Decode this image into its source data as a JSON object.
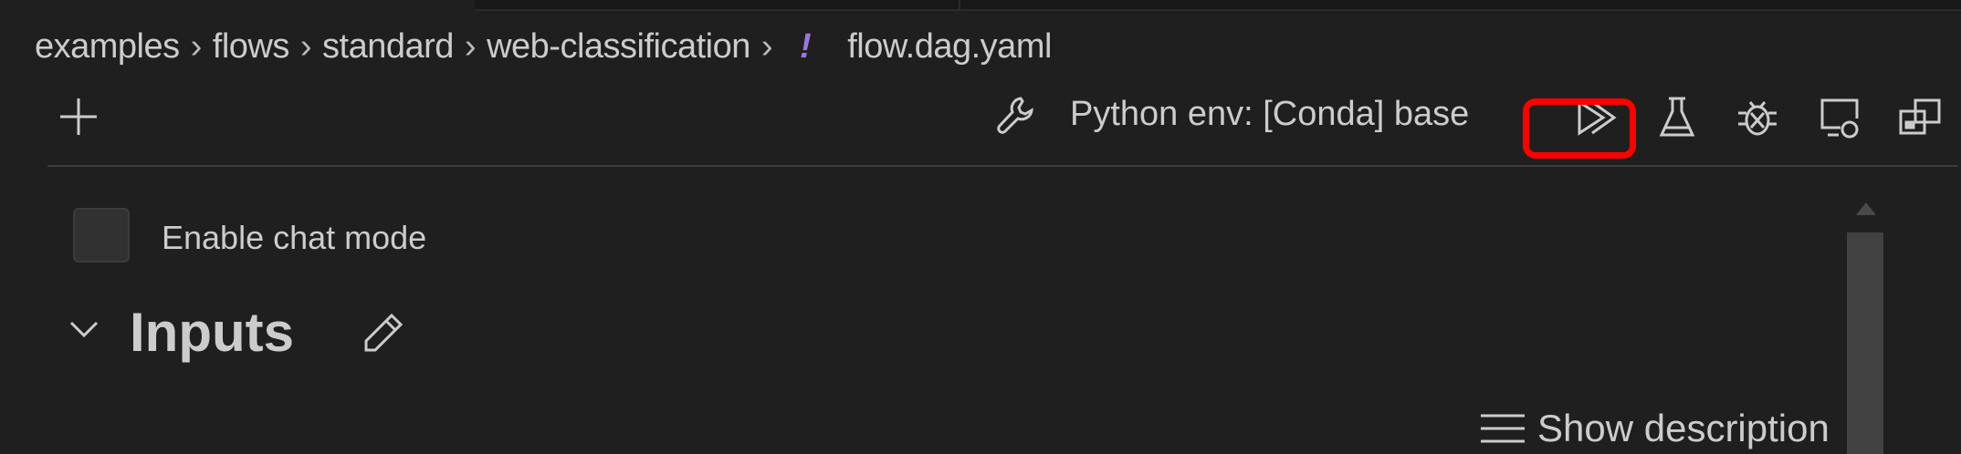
{
  "breadcrumb": {
    "items": [
      "examples",
      "flows",
      "standard",
      "web-classification"
    ],
    "file_icon": "yaml-exclamation-icon",
    "file": "flow.dag.yaml",
    "separator": "›"
  },
  "toolbar": {
    "add_icon": "plus-icon",
    "env_icon": "wrench-icon",
    "env_label": "Python env: [Conda] base",
    "actions": [
      "run-all-icon",
      "test-flask-icon",
      "debug-bug-icon",
      "remote-screen-icon",
      "layout-icon"
    ],
    "highlight_color": "#ff0000"
  },
  "chat_mode": {
    "label": "Enable chat mode",
    "checked": false
  },
  "inputs": {
    "title": "Inputs",
    "expanded": true
  },
  "show_description": {
    "label": "Show description"
  },
  "colors": {
    "background": "#1f1f1f",
    "text": "#cccccc",
    "yaml_icon": "#a074e0"
  }
}
